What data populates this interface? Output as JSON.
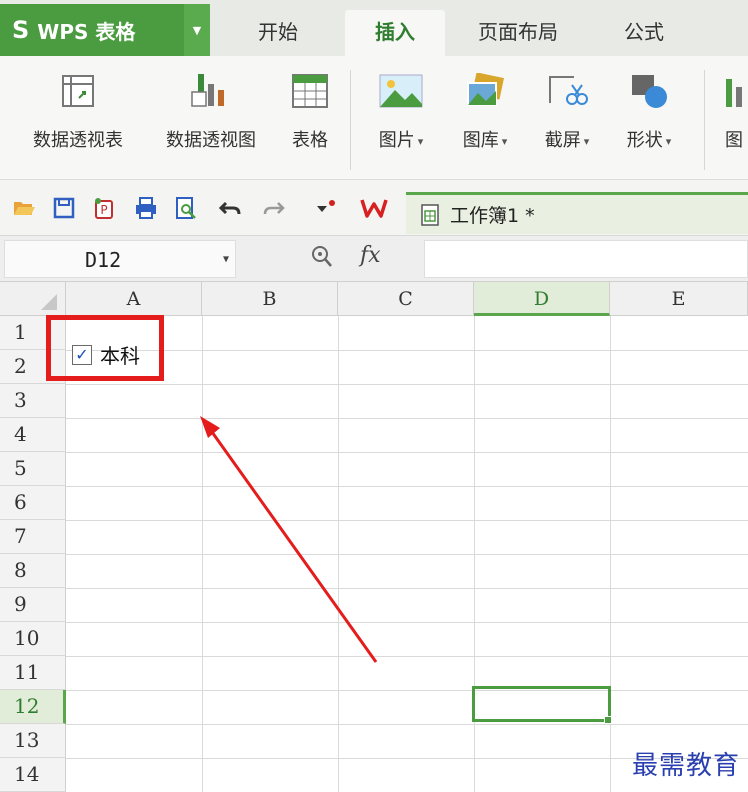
{
  "app": {
    "logo": "S",
    "name": "WPS 表格",
    "menu_arrow": "▼"
  },
  "tabs": [
    {
      "label": "开始"
    },
    {
      "label": "插入"
    },
    {
      "label": "页面布局"
    },
    {
      "label": "公式"
    }
  ],
  "active_tab": "插入",
  "ribbon": {
    "items": [
      {
        "label": "数据透视表",
        "icon": "pivot-table-icon",
        "dropdown": false
      },
      {
        "label": "数据透视图",
        "icon": "pivot-chart-icon",
        "dropdown": false
      },
      {
        "label": "表格",
        "icon": "table-icon",
        "dropdown": false
      },
      {
        "label": "图片",
        "icon": "picture-icon",
        "dropdown": true
      },
      {
        "label": "图库",
        "icon": "gallery-icon",
        "dropdown": true
      },
      {
        "label": "截屏",
        "icon": "screenshot-icon",
        "dropdown": true
      },
      {
        "label": "形状",
        "icon": "shape-icon",
        "dropdown": true
      },
      {
        "label": "图",
        "icon": "chart-icon",
        "dropdown": false
      }
    ]
  },
  "quick_access": {
    "icons": [
      "open-folder-icon",
      "save-icon",
      "export-icon",
      "print-icon",
      "print-preview-icon",
      "undo-icon",
      "redo-icon",
      "customize-icon",
      "wps-logo-icon"
    ],
    "document_title": "工作簿1 *"
  },
  "formula_bar": {
    "cell_ref": "D12",
    "fx_label": "fx",
    "formula_value": ""
  },
  "grid": {
    "columns": [
      "A",
      "B",
      "C",
      "D",
      "E"
    ],
    "rows": [
      "1",
      "2",
      "3",
      "4",
      "5",
      "6",
      "7",
      "8",
      "9",
      "10",
      "11",
      "12",
      "13",
      "14"
    ],
    "selected_column": "D",
    "selected_row": "12",
    "checkbox": {
      "label": "本科",
      "checked": true,
      "check_mark": "✓"
    }
  },
  "watermark": "最需教育",
  "colors": {
    "brand_green": "#4b9b40",
    "annotation_red": "#e51c1c",
    "checkbox_blue": "#1a4fb5",
    "watermark_blue": "#2a3fb0"
  }
}
